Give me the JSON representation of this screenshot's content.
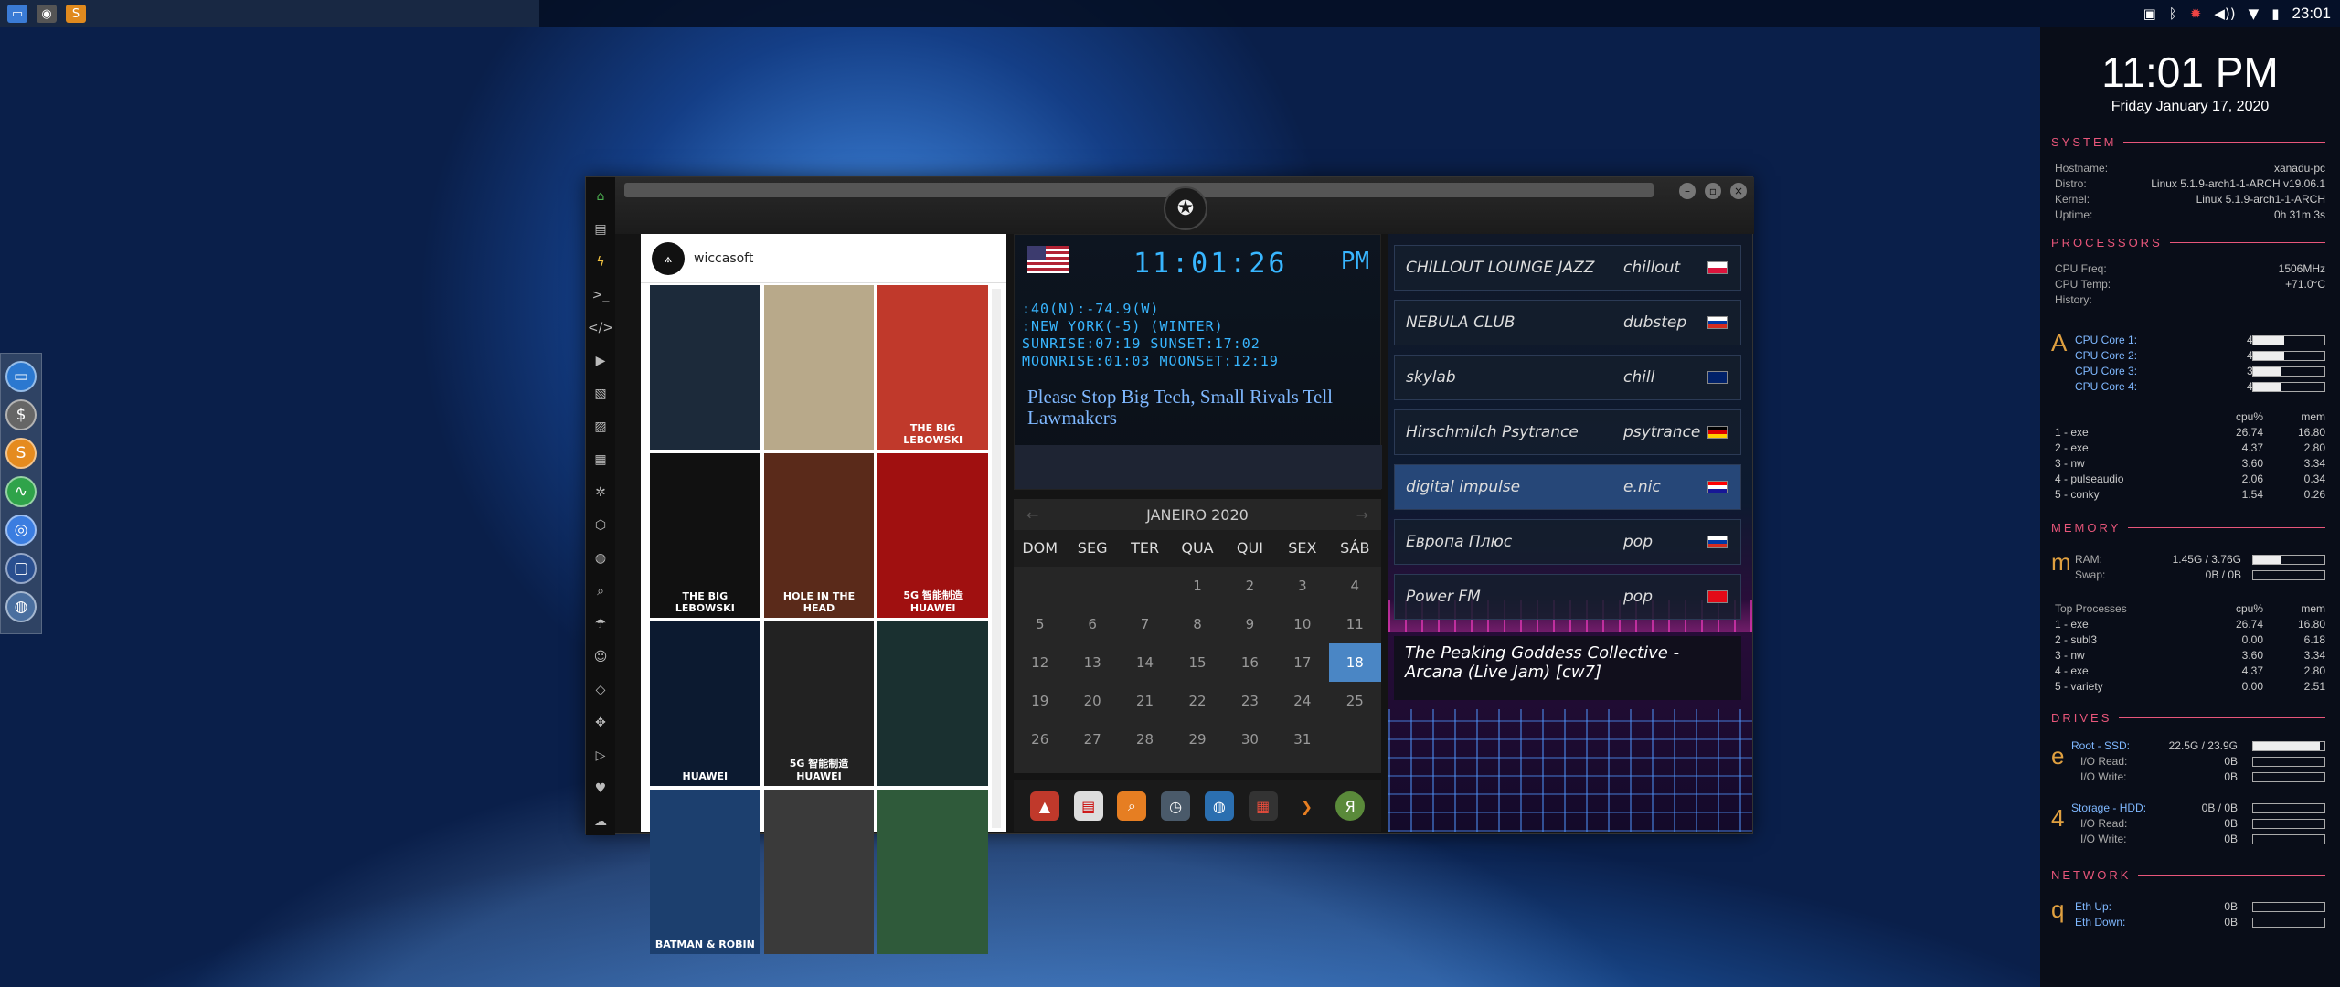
{
  "taskbar": {
    "clock": "23:01",
    "tray_icons": [
      "image-icon",
      "bluetooth-icon",
      "update-icon",
      "volume-icon",
      "wifi-icon",
      "battery-icon"
    ]
  },
  "app": {
    "instagram": {
      "username": "wiccasoft",
      "posts": [
        {
          "caption": "",
          "bg": "#1c2a3a"
        },
        {
          "caption": "",
          "bg": "#b8a98a"
        },
        {
          "caption": "THE BIG LEBOWSKI",
          "bg": "#c0392b"
        },
        {
          "caption": "THE BIG LEBOWSKI",
          "bg": "#111"
        },
        {
          "caption": "HOLE IN THE HEAD",
          "bg": "#5a2a1a"
        },
        {
          "caption": "5G 智能制造 HUAWEI",
          "bg": "#a01010"
        },
        {
          "caption": "HUAWEI",
          "bg": "#0c1a30"
        },
        {
          "caption": "5G 智能制造 HUAWEI",
          "bg": "#222"
        },
        {
          "caption": "",
          "bg": "#1a3030"
        },
        {
          "caption": "BATMAN & ROBIN",
          "bg": "#1c3f6e"
        },
        {
          "caption": "",
          "bg": "#3a3a3a"
        },
        {
          "caption": "",
          "bg": "#2f5a3a"
        }
      ]
    },
    "clock": {
      "time": "11:01:26",
      "ampm": "PM",
      "coords": [
        ":40(N):-74.9(W)",
        ":NEW YORK(-5) (WINTER)",
        "SUNRISE:07:19 SUNSET:17:02",
        "MOONRISE:01:03 MOONSET:12:19"
      ],
      "headline": "Please Stop Big Tech, Small Rivals Tell Lawmakers"
    },
    "calendar": {
      "month": "JANEIRO 2020",
      "dow": [
        "DOM",
        "SEG",
        "TER",
        "QUA",
        "QUI",
        "SEX",
        "SÁB"
      ],
      "days": [
        "",
        "",
        "",
        "1",
        "2",
        "3",
        "4",
        "5",
        "6",
        "7",
        "8",
        "9",
        "10",
        "11",
        "12",
        "13",
        "14",
        "15",
        "16",
        "17",
        "18",
        "19",
        "20",
        "21",
        "22",
        "23",
        "24",
        "25",
        "26",
        "27",
        "28",
        "29",
        "30",
        "31",
        ""
      ],
      "selected": "18"
    },
    "radio": {
      "stations": [
        {
          "name": "CHILLOUT LOUNGE JAZZ",
          "genre": "chillout",
          "flag": "pl"
        },
        {
          "name": "NEBULA CLUB",
          "genre": "dubstep",
          "flag": "ru"
        },
        {
          "name": "skylab",
          "genre": "chill",
          "flag": "uk"
        },
        {
          "name": "Hirschmilch Psytrance",
          "genre": "psytrance",
          "flag": "de"
        },
        {
          "name": "digital impulse",
          "genre": "e.nic",
          "flag": "hr"
        },
        {
          "name": "Европа Плюс",
          "genre": "pop",
          "flag": "ru"
        },
        {
          "name": "Power FM",
          "genre": "pop",
          "flag": "tr"
        }
      ],
      "now_playing": "The Peaking Goddess Collective - Arcana (Live Jam) [cw7]"
    }
  },
  "conky": {
    "time": "11:01 PM",
    "date": "Friday January 17, 2020",
    "system": {
      "title": "SYSTEM",
      "rows": [
        [
          "Hostname:",
          "xanadu-pc"
        ],
        [
          "Distro:",
          "Linux 5.1.9-arch1-1-ARCH v19.06.1"
        ],
        [
          "Kernel:",
          "Linux 5.1.9-arch1-1-ARCH"
        ],
        [
          "Uptime:",
          "0h 31m 3s"
        ]
      ]
    },
    "processors": {
      "title": "PROCESSORS",
      "rows": [
        [
          "CPU Freq:",
          "1506MHz"
        ],
        [
          "CPU Temp:",
          "+71.0°C"
        ],
        [
          "History:",
          ""
        ]
      ],
      "icon": "A",
      "cores": [
        [
          "CPU Core 1:",
          "43%",
          0.43
        ],
        [
          "CPU Core 2:",
          "43%",
          0.43
        ],
        [
          "CPU Core 3:",
          "39%",
          0.39
        ],
        [
          "CPU Core 4:",
          "40%",
          0.4
        ]
      ],
      "head": [
        "cpu%",
        "mem"
      ],
      "procs": [
        [
          "1 - exe",
          "26.74",
          "16.80"
        ],
        [
          "2 - exe",
          "4.37",
          "2.80"
        ],
        [
          "3 - nw",
          "3.60",
          "3.34"
        ],
        [
          "4 - pulseaudio",
          "2.06",
          "0.34"
        ],
        [
          "5 - conky",
          "1.54",
          "0.26"
        ]
      ]
    },
    "memory": {
      "title": "MEMORY",
      "icon": "m",
      "ram": [
        "RAM:",
        "1.45G / 3.76G",
        0.39
      ],
      "swap": [
        "Swap:",
        "0B / 0B",
        0
      ],
      "top_title": "Top Processes",
      "head": [
        "cpu%",
        "mem"
      ],
      "procs": [
        [
          "1 - exe",
          "26.74",
          "16.80"
        ],
        [
          "2 - subl3",
          "0.00",
          "6.18"
        ],
        [
          "3 - nw",
          "3.60",
          "3.34"
        ],
        [
          "4 - exe",
          "4.37",
          "2.80"
        ],
        [
          "5 - variety",
          "0.00",
          "2.51"
        ]
      ]
    },
    "drives": {
      "title": "DRIVES",
      "root": {
        "icon": "e",
        "label": "Root - SSD:",
        "val": "22.5G / 23.9G",
        "fill": 0.94,
        "rows": [
          [
            "I/O Read:",
            "0B"
          ],
          [
            "I/O Write:",
            "0B"
          ]
        ]
      },
      "storage": {
        "icon": "4",
        "label": "Storage - HDD:",
        "val": "0B / 0B",
        "fill": 0,
        "rows": [
          [
            "I/O Read:",
            "0B"
          ],
          [
            "I/O Write:",
            "0B"
          ]
        ]
      }
    },
    "network": {
      "title": "NETWORK",
      "icon": "q",
      "rows": [
        [
          "Eth Up:",
          "0B"
        ],
        [
          "Eth Down:",
          "0B"
        ]
      ]
    }
  }
}
